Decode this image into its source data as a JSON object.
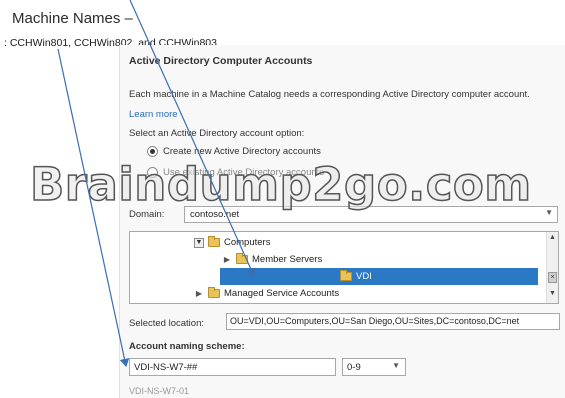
{
  "header": {
    "title": "Machine Names –",
    "machines": ": CCHWin801, CCHWin802, and CCHWin803"
  },
  "panel": {
    "title": "Active Directory Computer Accounts",
    "description": "Each machine in a Machine Catalog needs a corresponding Active Directory computer account.",
    "learn_more": "Learn more",
    "option_label": "Select an Active Directory account option:",
    "options": [
      {
        "label": "Create new Active Directory accounts",
        "selected": true
      },
      {
        "label": "Use existing Active Directory accounts",
        "selected": false
      }
    ],
    "domain_label": "Domain:",
    "domain_value": "contoso.net",
    "tree": [
      {
        "label": "Computers",
        "state": "expanded",
        "selected": false
      },
      {
        "label": "Member Servers",
        "state": "collapsed",
        "selected": false
      },
      {
        "label": "VDI",
        "state": "none",
        "selected": true
      },
      {
        "label": "Managed Service Accounts",
        "state": "collapsed",
        "selected": false
      }
    ],
    "selected_location_label": "Selected location:",
    "selected_location_value": "OU=VDI,OU=Computers,OU=San Diego,OU=Sites,DC=contoso,DC=net",
    "naming_label": "Account naming scheme:",
    "naming_value": "VDI-NS-W7-##",
    "naming_type": "0-9",
    "naming_preview": "VDI-NS-W7-01"
  },
  "watermark": "Braindump2go.com",
  "colors": {
    "selection": "#2b78c5",
    "link": "#2a6ebb",
    "arrow": "#3b6fb0",
    "folder": "#e9c25a"
  }
}
